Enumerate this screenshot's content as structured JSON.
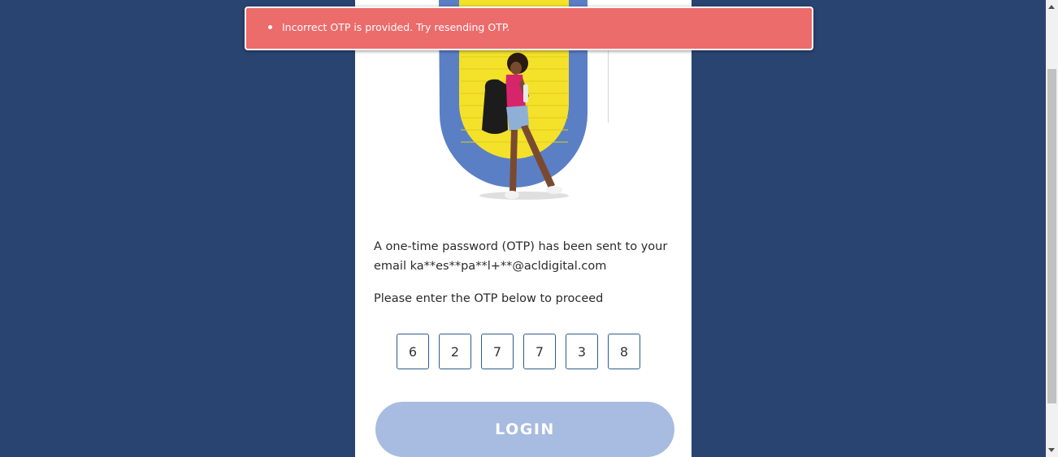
{
  "toast": {
    "message": "Incorrect OTP is provided. Try resending OTP."
  },
  "otp": {
    "message_line1": "A one-time password (OTP) has been sent to your",
    "message_line2": "email ka**es**pa**l+**@acldigital.com",
    "instruction": "Please enter the OTP below to proceed",
    "digits": [
      "6",
      "2",
      "7",
      "7",
      "3",
      "8"
    ]
  },
  "login_button": {
    "label": "LOGIN"
  },
  "colors": {
    "background": "#2a4472",
    "card": "#ffffff",
    "toast": "#ec6b6b",
    "button": "#a8bbe0",
    "box_border": "#2e5c8a"
  }
}
